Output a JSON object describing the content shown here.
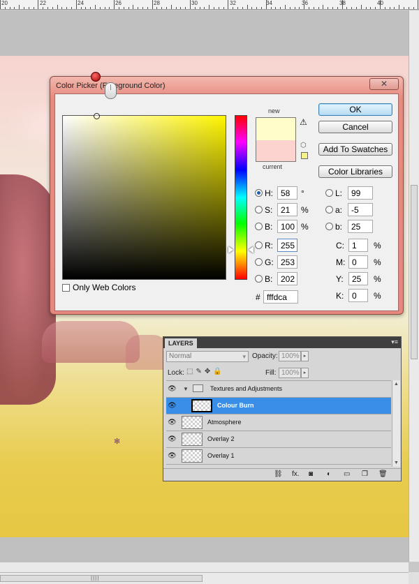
{
  "ruler": {
    "labels": [
      "20",
      "22",
      "24",
      "26",
      "28",
      "30",
      "32",
      "34",
      "36",
      "38",
      "40"
    ]
  },
  "dialog": {
    "title": "Color Picker (Foreground Color)",
    "close_glyph": "✕",
    "new_label": "new",
    "current_label": "current",
    "new_color": "#fffdca",
    "current_color": "#fdd3d0",
    "warn_glyph": "⚠",
    "cube_glyph": "⬡",
    "mini_swatch_color": "#f4f08c",
    "buttons": {
      "ok": "OK",
      "cancel": "Cancel",
      "add": "Add To Swatches",
      "libraries": "Color Libraries"
    },
    "hsb": [
      {
        "label": "H:",
        "value": "58",
        "unit": "°",
        "selected": true
      },
      {
        "label": "S:",
        "value": "21",
        "unit": "%"
      },
      {
        "label": "B:",
        "value": "100",
        "unit": "%"
      }
    ],
    "rgb": [
      {
        "label": "R:",
        "value": "255"
      },
      {
        "label": "G:",
        "value": "253"
      },
      {
        "label": "B:",
        "value": "202"
      }
    ],
    "lab": [
      {
        "label": "L:",
        "value": "99"
      },
      {
        "label": "a:",
        "value": "-5"
      },
      {
        "label": "b:",
        "value": "25"
      }
    ],
    "cmyk": [
      {
        "label": "C:",
        "value": "1",
        "unit": "%"
      },
      {
        "label": "M:",
        "value": "0",
        "unit": "%"
      },
      {
        "label": "Y:",
        "value": "25",
        "unit": "%"
      },
      {
        "label": "K:",
        "value": "0",
        "unit": "%"
      }
    ],
    "hex_label": "#",
    "hex_value": "fffdca",
    "only_web_colors": "Only Web Colors"
  },
  "layers": {
    "tab": "LAYERS",
    "menu_glyph": "▾≡",
    "blend_mode": "Normal",
    "opacity_label": "Opacity:",
    "opacity_value": "100%",
    "lock_label": "Lock:",
    "fill_label": "Fill:",
    "fill_value": "100%",
    "items": [
      {
        "name": "Textures and Adjustments",
        "type": "group"
      },
      {
        "name": "Colour Burn",
        "selected": true
      },
      {
        "name": "Atmosphere"
      },
      {
        "name": "Overlay 2"
      },
      {
        "name": "Overlay 1"
      }
    ],
    "footer_icons": [
      "link-icon",
      "fx-icon",
      "mask-icon",
      "adjustment-icon",
      "folder-icon",
      "new-layer-icon",
      "trash-icon"
    ],
    "fx_label": "fx."
  }
}
